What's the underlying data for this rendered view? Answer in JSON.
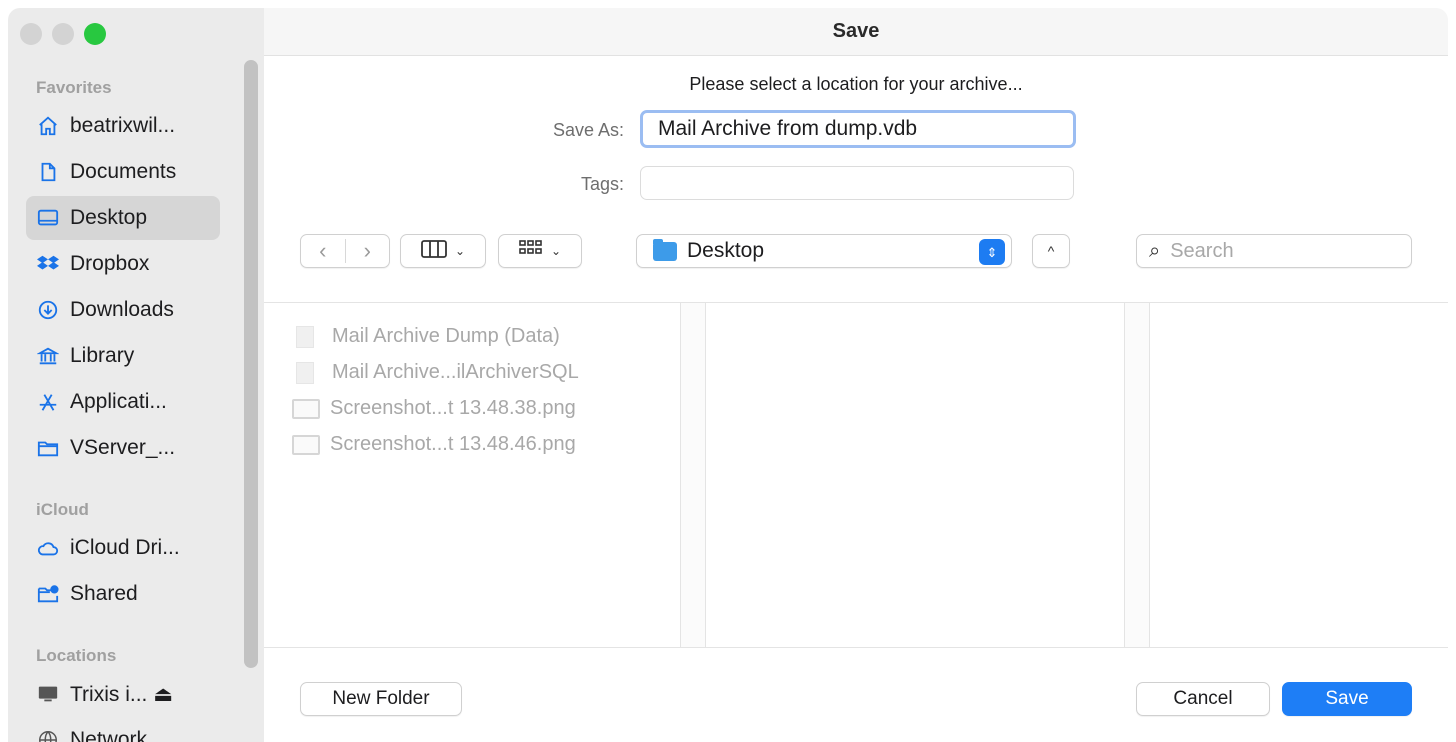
{
  "window": {
    "title": "Save"
  },
  "sidebar": {
    "sections": [
      {
        "heading": "Favorites",
        "items": [
          {
            "label": "beatrixwil...",
            "icon": "home-icon",
            "selected": false
          },
          {
            "label": "Documents",
            "icon": "document-icon",
            "selected": false
          },
          {
            "label": "Desktop",
            "icon": "desktop-icon",
            "selected": true
          },
          {
            "label": "Dropbox",
            "icon": "dropbox-icon",
            "selected": false
          },
          {
            "label": "Downloads",
            "icon": "download-icon",
            "selected": false
          },
          {
            "label": "Library",
            "icon": "library-icon",
            "selected": false
          },
          {
            "label": "Applicati...",
            "icon": "applications-icon",
            "selected": false
          },
          {
            "label": "VServer_...",
            "icon": "folder-icon",
            "selected": false
          }
        ]
      },
      {
        "heading": "iCloud",
        "items": [
          {
            "label": "iCloud Dri...",
            "icon": "cloud-icon",
            "selected": false
          },
          {
            "label": "Shared",
            "icon": "shared-folder-icon",
            "selected": false
          }
        ]
      },
      {
        "heading": "Locations",
        "items": [
          {
            "label": "Trixis i... ⏏",
            "icon": "computer-icon",
            "selected": false
          },
          {
            "label": "Network",
            "icon": "network-icon",
            "selected": false
          }
        ]
      }
    ]
  },
  "dialog": {
    "prompt": "Please select a location for your archive...",
    "save_as_label": "Save As:",
    "save_as_value": "Mail Archive from dump.vdb",
    "tags_label": "Tags:",
    "tags_value": "",
    "location": "Desktop",
    "search_placeholder": "Search"
  },
  "files": [
    {
      "name": "Mail Archive Dump (Data)",
      "type": "document"
    },
    {
      "name": "Mail Archive...ilArchiverSQL",
      "type": "document"
    },
    {
      "name": "Screenshot...t 13.48.38.png",
      "type": "image"
    },
    {
      "name": "Screenshot...t 13.48.46.png",
      "type": "image"
    }
  ],
  "buttons": {
    "new_folder": "New Folder",
    "cancel": "Cancel",
    "save": "Save"
  },
  "colors": {
    "accent": "#1e7ef6",
    "sidebar_bg": "#ebebeb",
    "close_traffic": "#d3d3d3",
    "zoom_traffic": "#28c840"
  }
}
